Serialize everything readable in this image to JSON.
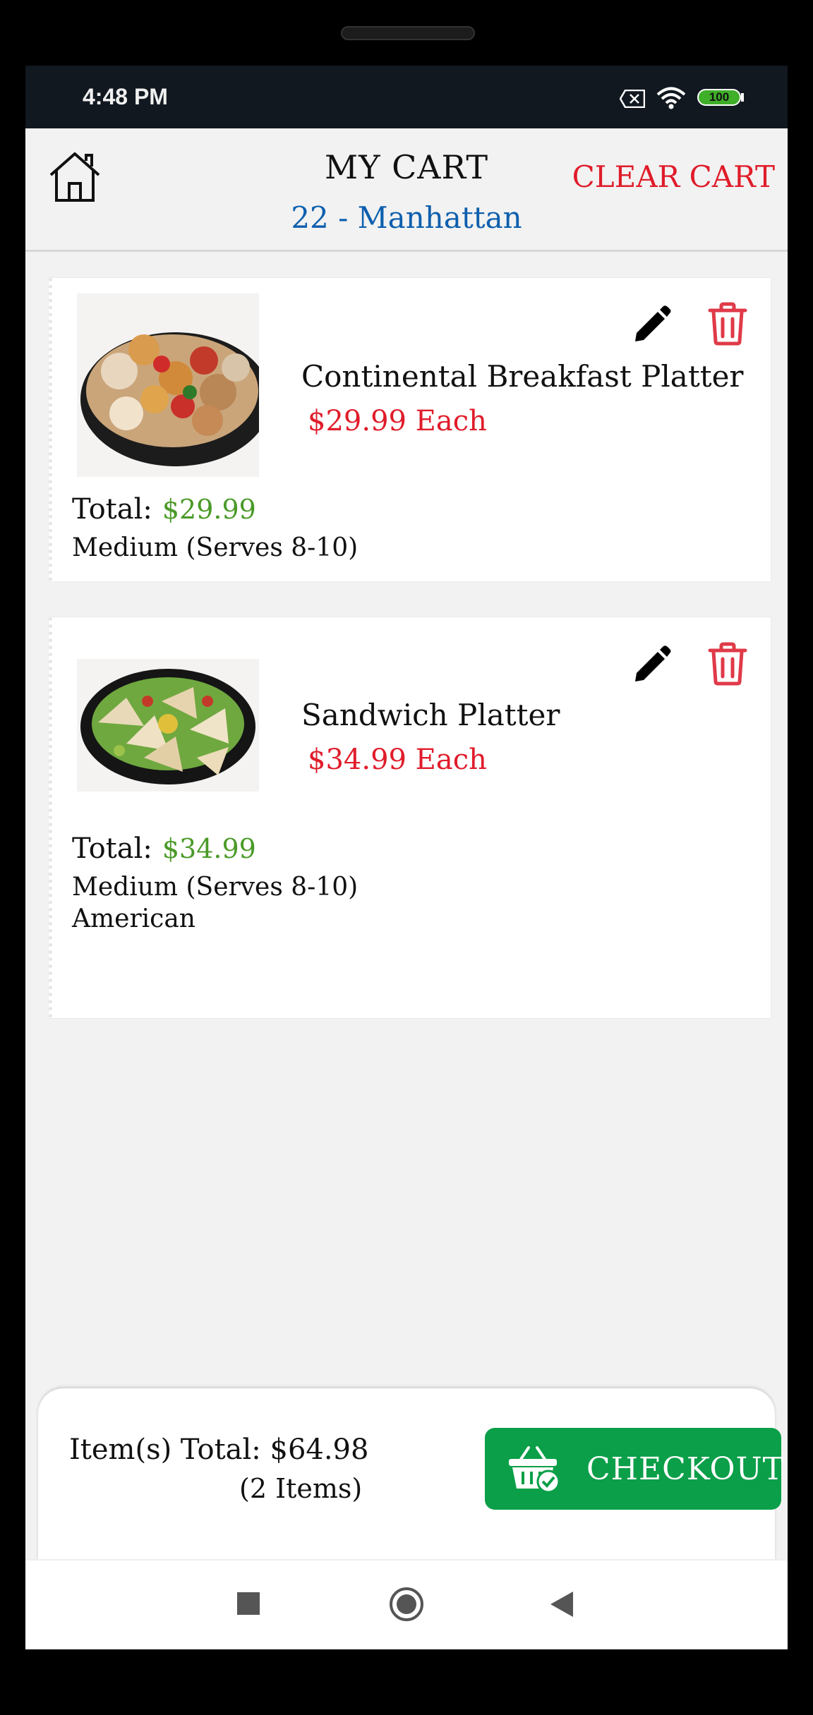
{
  "status_bar": {
    "time": "4:48 PM",
    "battery": "100"
  },
  "header": {
    "title": "MY CART",
    "subtitle": "22 - Manhattan",
    "clear_label": "CLEAR CART"
  },
  "items": [
    {
      "name": "Continental Breakfast Platter",
      "price": "$29.99 Each",
      "total_label": "Total:",
      "total": "$29.99",
      "options": [
        "Medium (Serves 8-10)"
      ]
    },
    {
      "name": "Sandwich Platter",
      "price": "$34.99 Each",
      "total_label": "Total:",
      "total": "$34.99",
      "options": [
        "Medium (Serves 8-10)",
        "American"
      ]
    }
  ],
  "summary": {
    "label": "Item(s) Total: $64.98",
    "count": "(2 Items)"
  },
  "checkout": {
    "label": "CHECKOUT"
  },
  "colors": {
    "accent_red": "#e01c2a",
    "checkout_green": "#0a9f48",
    "price_green": "#4a9a28",
    "location_blue": "#0d5fae",
    "status_bar": "#111820"
  },
  "nav": {
    "buttons": [
      "recents-icon",
      "home-circle-icon",
      "back-triangle-icon"
    ]
  }
}
